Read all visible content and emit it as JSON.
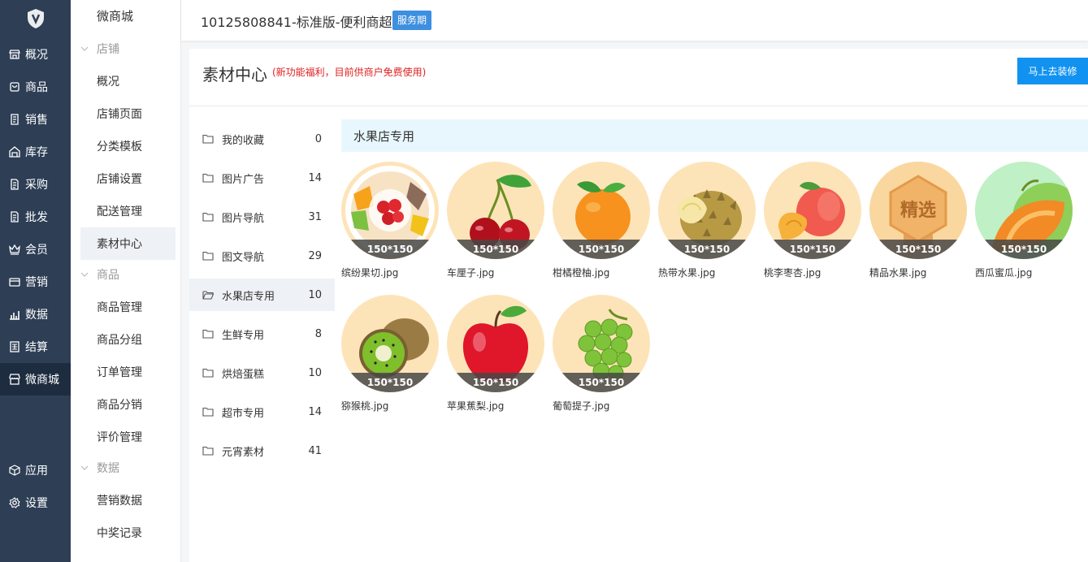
{
  "nav": {
    "items": [
      {
        "label": "概况",
        "icon": "shop-icon"
      },
      {
        "label": "商品",
        "icon": "bag-icon"
      },
      {
        "label": "销售",
        "icon": "receipt-icon"
      },
      {
        "label": "库存",
        "icon": "warehouse-icon"
      },
      {
        "label": "采购",
        "icon": "document-icon"
      },
      {
        "label": "批发",
        "icon": "document-icon"
      },
      {
        "label": "会员",
        "icon": "crown-icon"
      },
      {
        "label": "营销",
        "icon": "card-icon"
      },
      {
        "label": "数据",
        "icon": "chart-icon"
      },
      {
        "label": "结算",
        "icon": "ledger-icon"
      },
      {
        "label": "微商城",
        "icon": "store-icon"
      }
    ],
    "bottom": [
      {
        "label": "应用",
        "icon": "cube-icon"
      },
      {
        "label": "设置",
        "icon": "gear-icon"
      }
    ]
  },
  "sub": {
    "title": "微商城",
    "groups": [
      {
        "label": "店铺",
        "items": [
          "概况",
          "店铺页面",
          "分类模板",
          "店铺设置",
          "配送管理",
          "素材中心"
        ]
      },
      {
        "label": "商品",
        "items": [
          "商品管理",
          "商品分组",
          "订单管理",
          "商品分销",
          "评价管理"
        ]
      },
      {
        "label": "数据",
        "items": [
          "营销数据",
          "中奖记录"
        ]
      }
    ]
  },
  "header": {
    "title": "10125808841-标准版-便利商超",
    "badge": "服务期"
  },
  "panel": {
    "title": "素材中心",
    "note": "(新功能福利，目前供商户免费使用)",
    "decorate_button": "马上去装修"
  },
  "categories": [
    {
      "name": "我的收藏",
      "count": "0"
    },
    {
      "name": "图片广告",
      "count": "14"
    },
    {
      "name": "图片导航",
      "count": "31"
    },
    {
      "name": "图文导航",
      "count": "29"
    },
    {
      "name": "水果店专用",
      "count": "10",
      "active": true
    },
    {
      "name": "生鲜专用",
      "count": "8"
    },
    {
      "name": "烘焙蛋糕",
      "count": "10"
    },
    {
      "name": "超市专用",
      "count": "14"
    },
    {
      "name": "元宵素材",
      "count": "41"
    }
  ],
  "gallery": {
    "heading": "水果店专用",
    "size_label": "150*150",
    "items": [
      {
        "file": "缤纷果切.jpg",
        "art": "fruit-platter"
      },
      {
        "file": "车厘子.jpg",
        "art": "cherries"
      },
      {
        "file": "柑橘橙柚.jpg",
        "art": "orange"
      },
      {
        "file": "热带水果.jpg",
        "art": "durian"
      },
      {
        "file": "桃李枣杏.jpg",
        "art": "peach"
      },
      {
        "file": "精品水果.jpg",
        "art": "badge",
        "badge_text": "精选"
      },
      {
        "file": "西瓜蜜瓜.jpg",
        "art": "melon"
      },
      {
        "file": "猕猴桃.jpg",
        "art": "kiwi"
      },
      {
        "file": "苹果蕉梨.jpg",
        "art": "apple"
      },
      {
        "file": "葡萄提子.jpg",
        "art": "grapes"
      }
    ]
  },
  "colors": {
    "nav_bg": "#2d3e55",
    "accent": "#1292f0",
    "badge": "#3d8fe0",
    "note": "#e02020",
    "gallery_head_bg": "#e8f7fe"
  }
}
